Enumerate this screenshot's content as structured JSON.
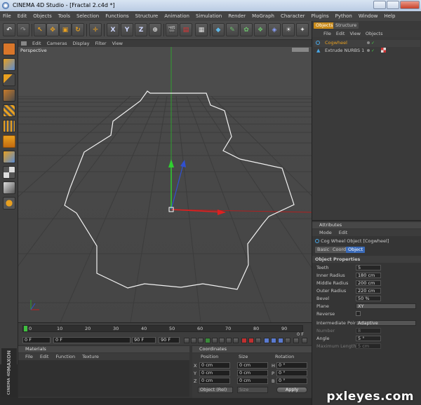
{
  "window": {
    "app_title": "CINEMA 4D Studio",
    "doc_title": "- [Fractal 2.c4d *]"
  },
  "menu": [
    "File",
    "Edit",
    "Objects",
    "Tools",
    "Selection",
    "Functions",
    "Structure",
    "Animation",
    "Simulation",
    "Render",
    "MoGraph",
    "Character",
    "Plugins",
    "Python",
    "Window",
    "Help"
  ],
  "toolbar": {
    "x_label": "X",
    "y_label": "Y",
    "z_label": "Z"
  },
  "viewport": {
    "menu": [
      "Edit",
      "Cameras",
      "Display",
      "Filter",
      "View"
    ],
    "label": "Perspective"
  },
  "timeline": {
    "ticks": [
      "0",
      "10",
      "20",
      "30",
      "40",
      "50",
      "60",
      "70",
      "80",
      "90"
    ],
    "end_label": "0 F",
    "start_field": "0 F",
    "min_field": "0 F",
    "max_field": "90 F",
    "end_field": "90 F"
  },
  "materials": {
    "title": "Materials",
    "menu": [
      "File",
      "Edit",
      "Function",
      "Texture"
    ]
  },
  "coordinates": {
    "title": "Coordinates",
    "headers": [
      "Position",
      "Size",
      "Rotation"
    ],
    "rows": [
      {
        "axis": "X",
        "pos": "0 cm",
        "size": "0 cm",
        "rot_axis": "H",
        "rot": "0 °"
      },
      {
        "axis": "Y",
        "pos": "0 cm",
        "size": "0 cm",
        "rot_axis": "P",
        "rot": "0 °"
      },
      {
        "axis": "Z",
        "pos": "0 cm",
        "size": "0 cm",
        "rot_axis": "B",
        "rot": "0 °"
      }
    ],
    "mode": "Object (Rel)",
    "size_mode": "Size",
    "apply_label": "Apply"
  },
  "objects": {
    "tabs": [
      "Objects",
      "Structure"
    ],
    "menu": [
      "File",
      "Edit",
      "View",
      "Objects"
    ],
    "items": [
      {
        "name": "Cogwheel"
      },
      {
        "name": "Extrude NURBS 1"
      }
    ]
  },
  "attributes": {
    "title": "Attributes",
    "menu": [
      "Mode",
      "Edit"
    ],
    "object_name": "Cog Wheel Object [Cogwheel]",
    "tabs": [
      "Basic",
      "Coord.",
      "Object"
    ],
    "section": "Object Properties",
    "props": [
      {
        "label": "Teeth",
        "value": "5"
      },
      {
        "label": "Inner Radius",
        "value": "180 cm"
      },
      {
        "label": "Middle Radius",
        "value": "200 cm"
      },
      {
        "label": "Outer Radius",
        "value": "220 cm"
      },
      {
        "label": "Bevel",
        "value": "50 %"
      }
    ],
    "plane_label": "Plane",
    "plane_value": "XY",
    "reverse_label": "Reverse",
    "ip_label": "Intermediate Points",
    "ip_value": "Adaptive",
    "number_label": "Number",
    "number_value": "8",
    "angle_label": "Angle",
    "angle_value": "5 °",
    "maxlen_label": "Maximum Length",
    "maxlen_value": "5 cm"
  },
  "branding": {
    "maxon": "MAXON",
    "cinema": "CINEMA 4D"
  },
  "watermark": "pxleyes.com"
}
